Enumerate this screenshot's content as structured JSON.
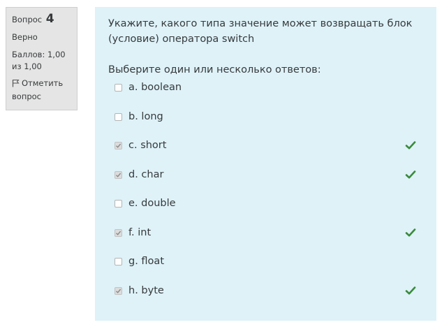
{
  "info": {
    "question_label": "Вопрос",
    "question_number": "4",
    "state": "Верно",
    "grade": "Баллов: 1,00 из 1,00",
    "flag_label": "Отметить вопрос"
  },
  "question": {
    "text": "Укажите, какого типа значение может возвращать блок (условие) оператора switch",
    "prompt": "Выберите один или несколько ответов:"
  },
  "answers": [
    {
      "label": "a. boolean",
      "checked": false,
      "correct": false
    },
    {
      "label": "b. long",
      "checked": false,
      "correct": false
    },
    {
      "label": "c. short",
      "checked": true,
      "correct": true
    },
    {
      "label": "d. char",
      "checked": true,
      "correct": true
    },
    {
      "label": "e. double",
      "checked": false,
      "correct": false
    },
    {
      "label": "f. int",
      "checked": true,
      "correct": true
    },
    {
      "label": "g. float",
      "checked": false,
      "correct": false
    },
    {
      "label": "h. byte",
      "checked": true,
      "correct": true
    }
  ],
  "colors": {
    "info_bg": "#e5e5e5",
    "content_bg": "#def2f8",
    "correct_tick": "#3a8a3a"
  }
}
